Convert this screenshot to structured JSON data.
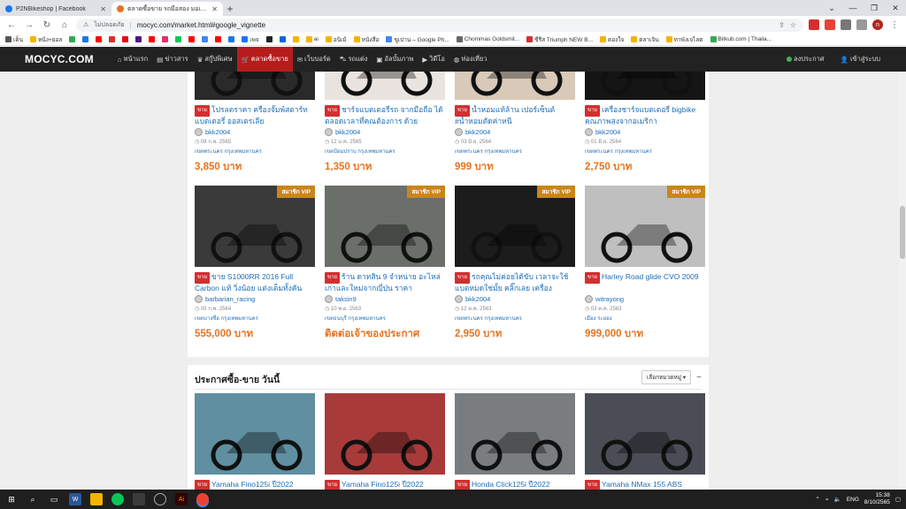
{
  "browser": {
    "tabs": [
      {
        "title": "P2NBikeshop | Facebook",
        "color": "#1877f2",
        "active": false
      },
      {
        "title": "ตลาดซื้อขาย รถมือสอง มอเตอร์ไซค์มือสอง",
        "color": "#e8731c",
        "active": true
      }
    ],
    "address": {
      "security": "ไม่ปลอดภัย",
      "url": "mocyc.com/market.html#google_vignette"
    },
    "bookmarks": [
      {
        "label": "เค็น",
        "color": "#555"
      },
      {
        "label": "หน้ง+ยอล",
        "color": "#f4b400"
      },
      {
        "label": "",
        "color": "#34a853"
      },
      {
        "label": "",
        "color": "#1877f2"
      },
      {
        "label": "",
        "color": "#ff0000"
      },
      {
        "label": "",
        "color": "#d32f2f"
      },
      {
        "label": "",
        "color": "#e50914"
      },
      {
        "label": "",
        "color": "#4a148c"
      },
      {
        "label": "",
        "color": "#ff0000"
      },
      {
        "label": "",
        "color": "#e1306c"
      },
      {
        "label": "",
        "color": "#06c755"
      },
      {
        "label": "",
        "color": "#ff0000"
      },
      {
        "label": "",
        "color": "#4285f4"
      },
      {
        "label": "",
        "color": "#ff0000"
      },
      {
        "label": "",
        "color": "#1877f2"
      },
      {
        "label": "เพจ",
        "color": "#1877f2"
      },
      {
        "label": "",
        "color": "#222"
      },
      {
        "label": "",
        "color": "#0668e1"
      },
      {
        "label": "",
        "color": "#f4b400"
      },
      {
        "label": "ai",
        "color": "#f4b400"
      },
      {
        "label": "อนิเม้",
        "color": "#f4b400"
      },
      {
        "label": "หนังสือ",
        "color": "#f4b400"
      },
      {
        "label": "ขูเปาน – Google Ph...",
        "color": "#4285f4"
      },
      {
        "label": "Chommas Goldsmit...",
        "color": "#666"
      },
      {
        "label": "ซีรีส Triumph NEW B...",
        "color": "#d32f2f"
      },
      {
        "label": "ดองใจ",
        "color": "#f4b400"
      },
      {
        "label": "ตลาเจิน",
        "color": "#f4b400"
      },
      {
        "label": "ทาพังเจไลต",
        "color": "#f4b400"
      },
      {
        "label": "Bitkub.com | Thaila...",
        "color": "#34a853"
      }
    ],
    "profile_initial": "n"
  },
  "site": {
    "logo": "MOCYC.COM",
    "nav": [
      {
        "label": "หน้าแรก",
        "icon": "home-icon",
        "active": false
      },
      {
        "label": "ข่าวสาร",
        "icon": "doc-icon",
        "active": false
      },
      {
        "label": "สกู๊ปพิเศษ",
        "icon": "trophy-icon",
        "active": false
      },
      {
        "label": "ตลาดซื้อขาย",
        "icon": "cart-icon",
        "active": true
      },
      {
        "label": "เว็บบอร์ด",
        "icon": "chat-icon",
        "active": false
      },
      {
        "label": "รถแต่ง",
        "icon": "car-icon",
        "active": false
      },
      {
        "label": "อัลบั้มภาพ",
        "icon": "image-icon",
        "active": false
      },
      {
        "label": "วิดีโอ",
        "icon": "video-icon",
        "active": false
      },
      {
        "label": "ท่องเที่ยว",
        "icon": "globe-icon",
        "active": false
      }
    ],
    "right": {
      "post": "ลงประกาศ",
      "login": "เข้าสู่ระบบ"
    }
  },
  "tag_label": "ขาย",
  "vip_label": "สมาชิก VIP",
  "listings_row1": [
    {
      "title": "โปรลดราคา ครื่องจั๊มพ์สตาร์ท แบตเตอรี่ ออสเตรเลีย",
      "seller": "bkk2004",
      "date": "08 ก.พ. 2565",
      "loc": "เขตพระนคร  กรุงเทพมหานคร",
      "price": "3,850 บาท",
      "img": "#2a2a2a"
    },
    {
      "title": "ชาร์จแบตเตอรี่รถ จากมือถือ ได้ตลอดเวลาที่คุณต้องการ ด้วย",
      "seller": "bkk2004",
      "date": "12 ม.ค. 2565",
      "loc": "เขตป้อมปราบ  กรุงเทพมหานคร",
      "price": "1,350 บาท",
      "img": "#e9e4df"
    },
    {
      "title": "น้ำหอมแท้ล้าน เปอร์เซ็นต์ #น้ำหอมตัดค่าหนี",
      "seller": "bkk2004",
      "date": "03 มิ.ย. 2564",
      "loc": "เขตพระนคร  กรุงเทพมหานคร",
      "price": "999 บาท",
      "img": "#d9c9b8"
    },
    {
      "title": "เครื่องชาร์จแบตเตอรี่ bigbike คุณภาพสูงจากอเมริกา",
      "seller": "bkk2004",
      "date": "01 มิ.ย. 2564",
      "loc": "เขตพระนคร  กรุงเทพมหานคร",
      "price": "2,750 บาท",
      "img": "#151515"
    }
  ],
  "listings_row2": [
    {
      "title": "ขาย S1000RR 2016 Full Carbon แท้ วิ่งน้อย แต่งเต็มทั้งคัน",
      "seller": "barbarian_racing",
      "date": "05 ก.พ. 2564",
      "loc": "เขตบางซื่อ  กรุงเทพมหานคร",
      "price": "555,000 บาท",
      "vip": true,
      "img": "#3a3a3a",
      "price_color": "#e8731c"
    },
    {
      "title": "ร้าน ดาทสิน 9 จำหน่าย อะไหล่เก่าและใหม่จากญี่ปุ่น ราคา",
      "seller": "taksin9",
      "date": "10 พ.ย. 2563",
      "loc": "เขตธนบุรี  กรุงเทพมหานคร",
      "price": "ติดต่อเจ้าของประกาศ",
      "vip": true,
      "img": "#6b6f6a",
      "price_color": "#e8731c"
    },
    {
      "title": "รถคุณไม่ค่อยได้ขับ เวลาจะใช้ แบตหมดใช่มั้ย คลิ๊กเลย เครื่อง",
      "seller": "bkk2004",
      "date": "12 ต.ค. 2563",
      "loc": "เขตพระนคร  กรุงเทพมหานคร",
      "price": "2,950 บาท",
      "vip": true,
      "img": "#1c1c1c",
      "price_color": "#e8731c"
    },
    {
      "title": "Harley Road glide CVO 2009",
      "seller": "witrayong",
      "date": "03 ต.ค. 2563",
      "loc": "เมือง  ระยอง",
      "price": "999,000 บาท",
      "vip": true,
      "img": "#bfbfbf",
      "price_color": "#e8731c"
    }
  ],
  "today": {
    "heading": "ประกาศซื้อ-ขาย วันนี้",
    "select": "เลือกหมวดหมู่",
    "items": [
      {
        "title": "Yamaha Fino125i ปี2022",
        "img": "#5f8fa0"
      },
      {
        "title": "Yamaha Fino125i ปี2022",
        "img": "#a83a3a"
      },
      {
        "title": "Honda Click125i ปี2022",
        "img": "#7a7d80"
      },
      {
        "title": "Yamaha NMax 155 ABS",
        "img": "#4a4d55"
      }
    ]
  },
  "taskbar": {
    "lang": "ENG",
    "time": "15:38",
    "date": "8/10/2565"
  }
}
